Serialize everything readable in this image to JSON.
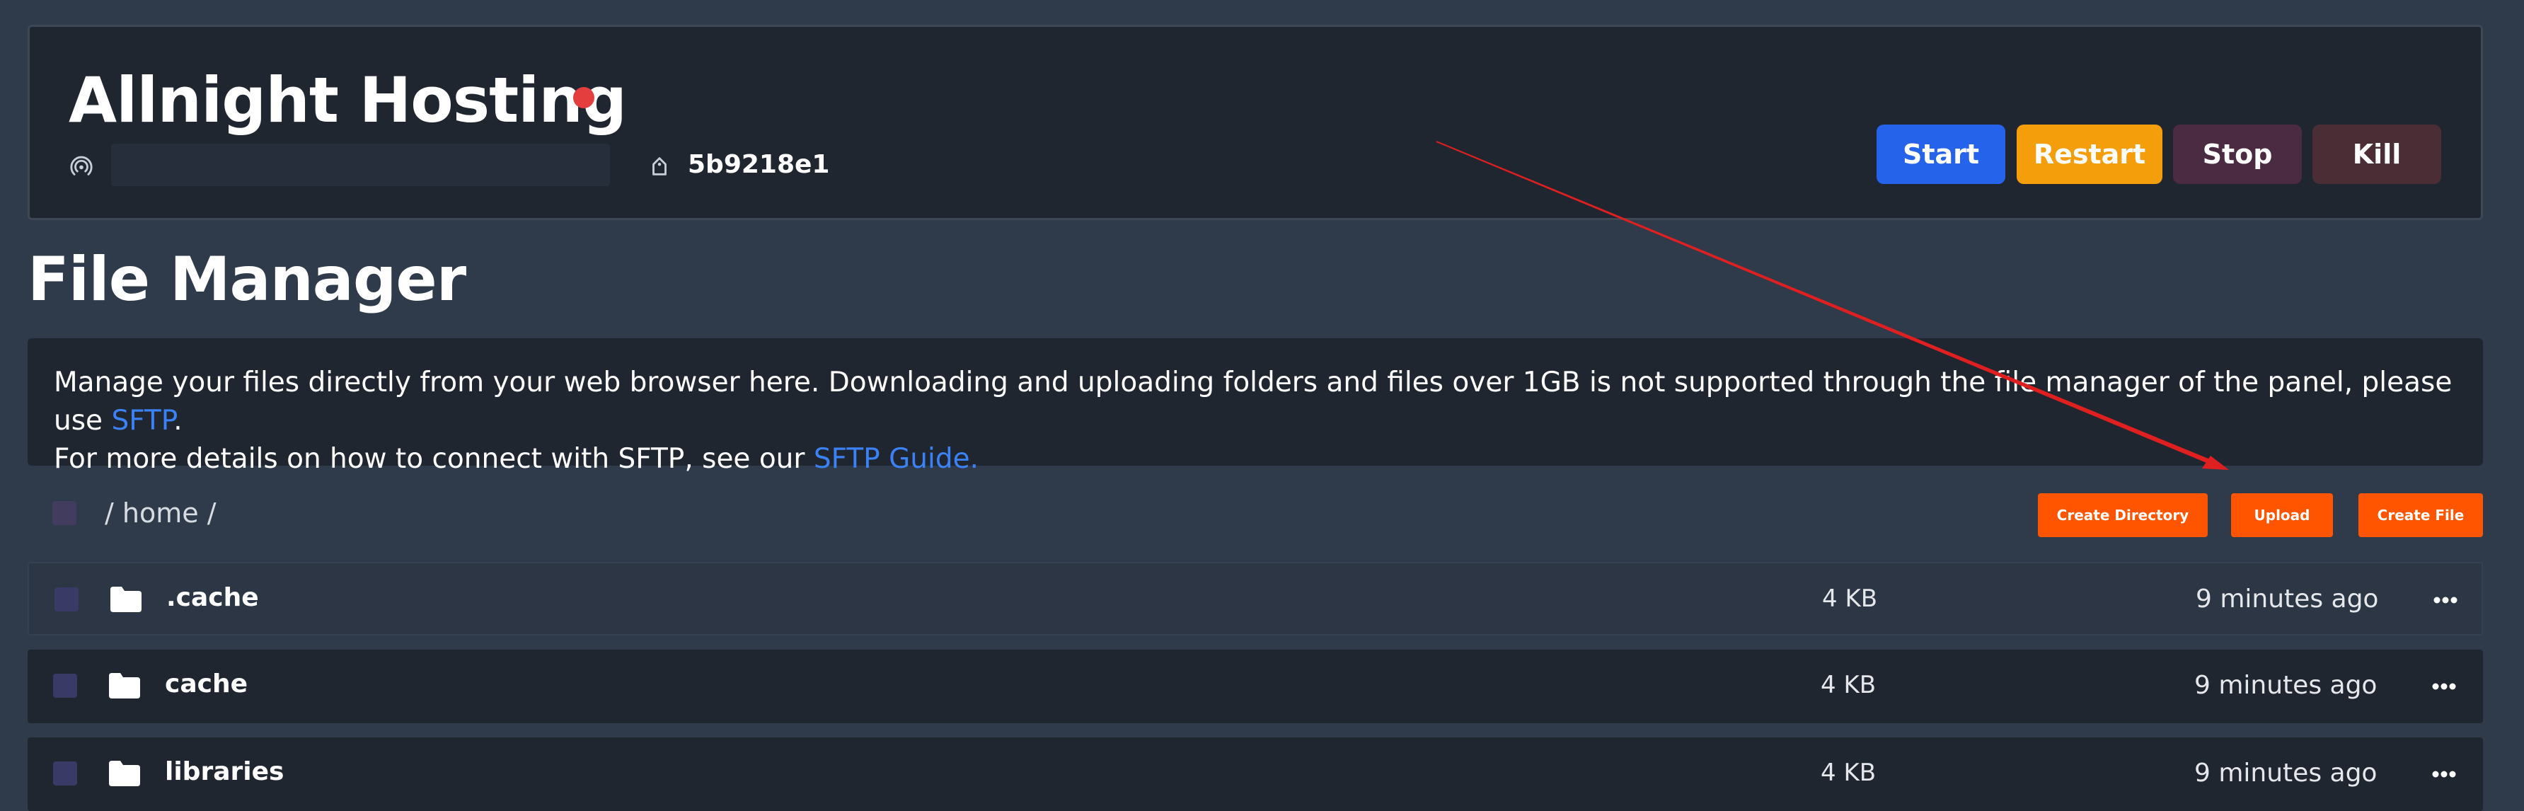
{
  "server": {
    "name": "Allnight Hosting",
    "ip": "",
    "id": "5b9218e1"
  },
  "power": {
    "start": "Start",
    "restart": "Restart",
    "stop": "Stop",
    "kill": "Kill"
  },
  "page": {
    "title": "File Manager"
  },
  "info": {
    "text1": "Manage your files directly from your web browser here. Downloading and uploading folders and files over 1GB is not supported through the file manager of the panel, please use ",
    "link1": "SFTP",
    "text2": ".",
    "text3": "For more details on how to connect with SFTP, see our ",
    "link2": "SFTP Guide."
  },
  "toolbar": {
    "breadcrumb": "/ home /",
    "create_directory": "Create Directory",
    "upload": "Upload",
    "create_file": "Create File"
  },
  "files": [
    {
      "name": ".cache",
      "size": "4 KB",
      "modified": "9 minutes ago"
    },
    {
      "name": "cache",
      "size": "4 KB",
      "modified": "9 minutes ago"
    },
    {
      "name": "libraries",
      "size": "4 KB",
      "modified": "9 minutes ago"
    }
  ],
  "icons": {
    "status": "status-dot-red",
    "ip": "wifi-signal-icon",
    "id": "id-tag-icon",
    "folder": "folder-icon",
    "more": "ellipsis-icon"
  },
  "colors": {
    "status_offline": "#e53e3e",
    "start": "#2563eb",
    "restart": "#f59e0b",
    "stop": "#4a2b42",
    "kill": "#4a2d35",
    "action": "#ff5500",
    "link": "#3b82f6",
    "annotation_arrow": "#e02020"
  }
}
